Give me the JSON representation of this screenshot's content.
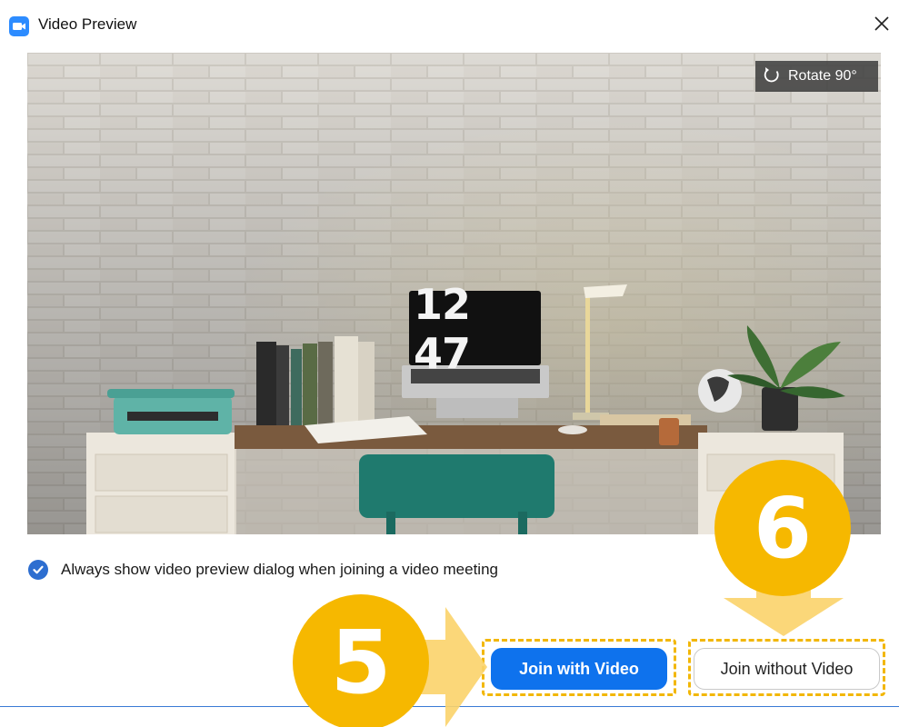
{
  "window": {
    "title": "Video Preview"
  },
  "icons": {
    "app": "zoom-app-icon",
    "close": "close-icon",
    "rotate": "rotate-icon",
    "checkbox": "checkmark-icon"
  },
  "preview": {
    "rotate_label": "Rotate 90°",
    "clock_display": "12 47"
  },
  "option": {
    "checked": true,
    "label": "Always show video preview dialog when joining a video meeting"
  },
  "buttons": {
    "join_with_video": "Join with Video",
    "join_without_video": "Join without Video"
  },
  "annotations": {
    "step_five": "5",
    "step_six": "6"
  },
  "colors": {
    "primary_button": "#0e72ed",
    "checkbox": "#2d6ed0",
    "annotation": "#f6b800",
    "annotation_arrow": "#fbd36a"
  }
}
